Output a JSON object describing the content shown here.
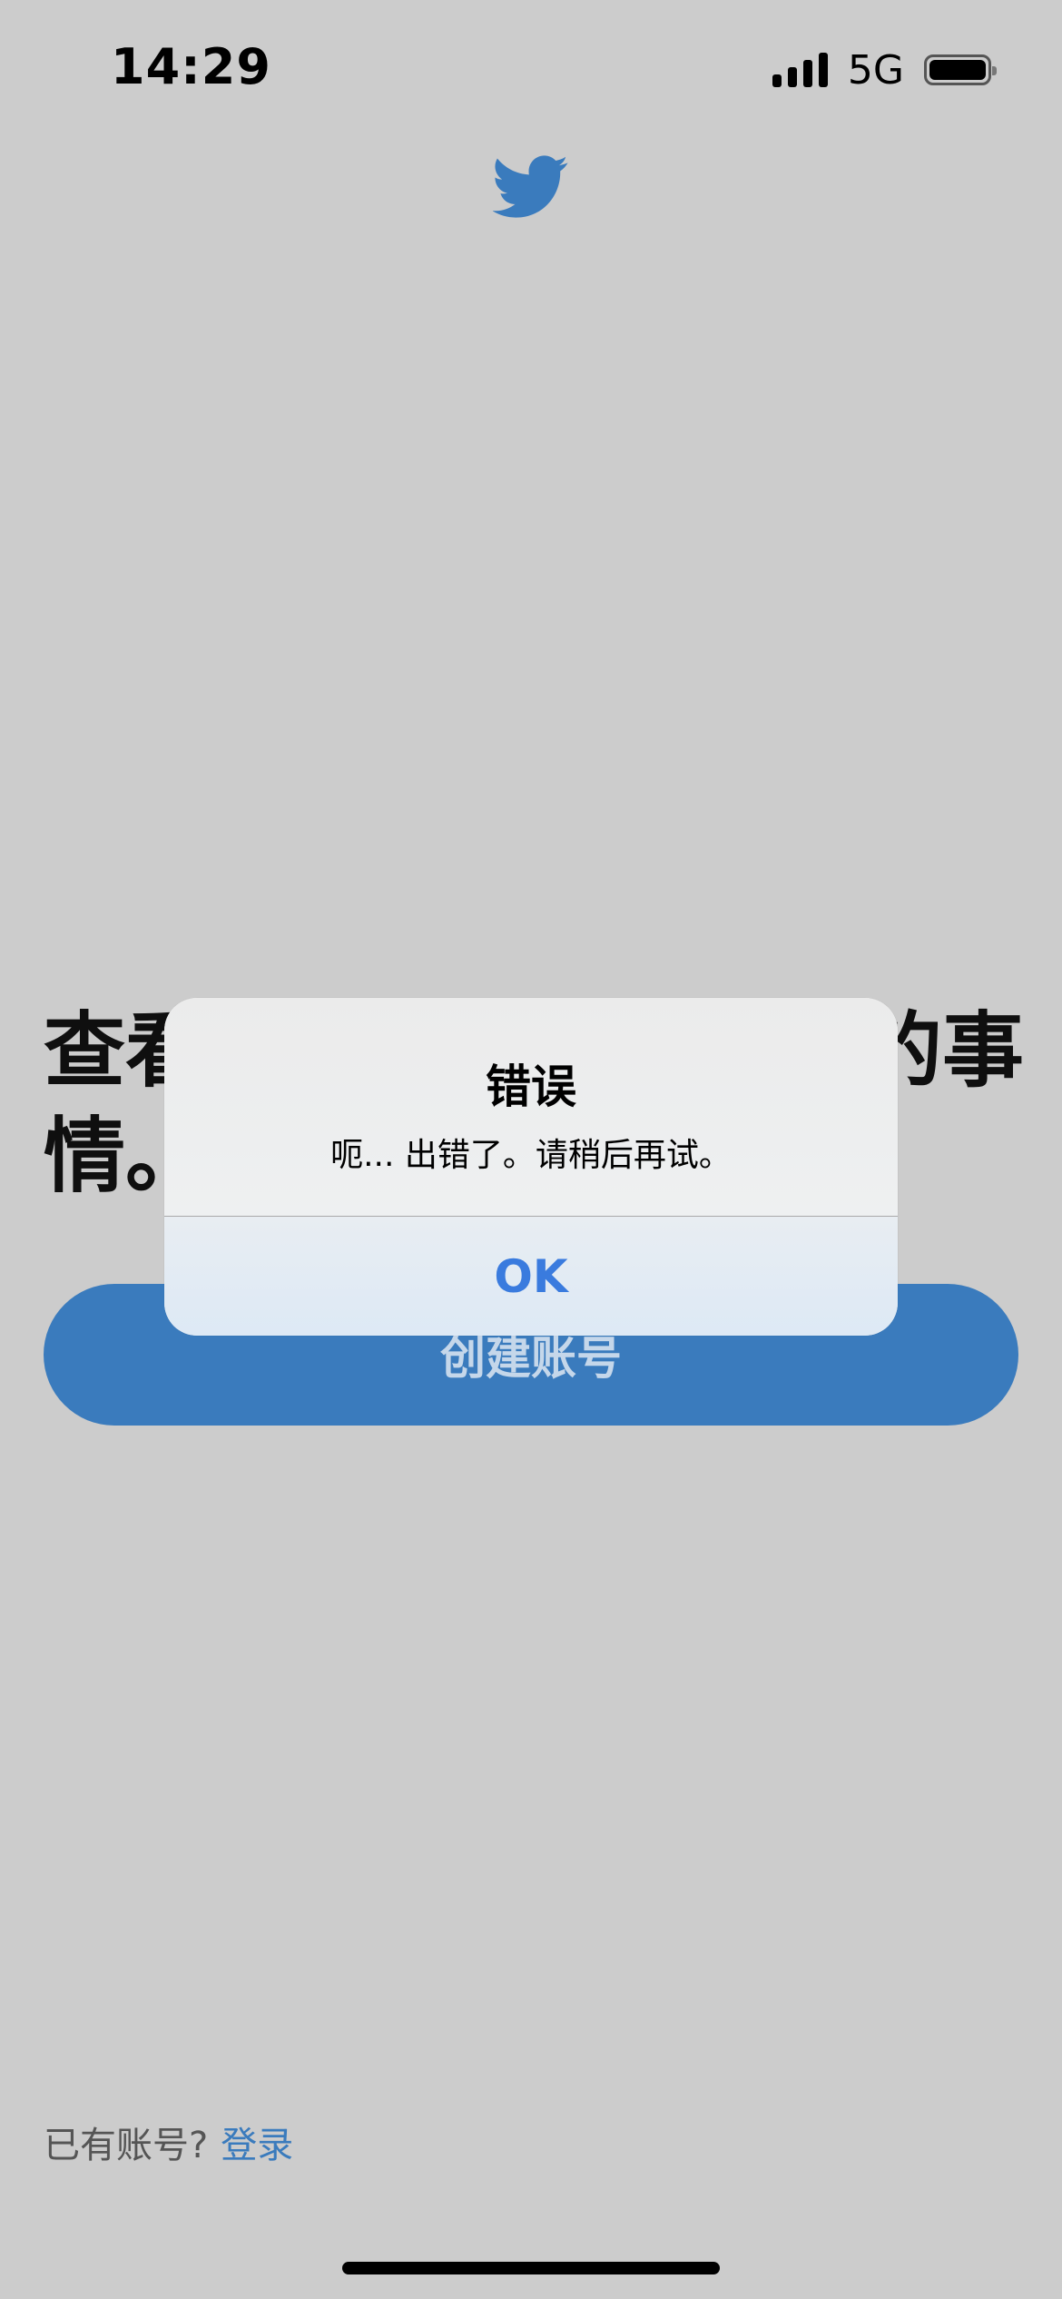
{
  "status_bar": {
    "time": "14:29",
    "network": "5G"
  },
  "icons": {
    "logo": "twitter-bird-icon",
    "signal": "cellular-signal-icon",
    "battery": "battery-icon"
  },
  "main": {
    "headline_line1_left": "查看",
    "headline_line1_right": "的事",
    "headline_line2": "情。",
    "create_account_label": "创建账号"
  },
  "footer": {
    "prompt": "已有账号?",
    "login_label": "登录"
  },
  "alert": {
    "title": "错误",
    "message": "呃... 出错了。请稍后再试。",
    "ok_label": "OK"
  },
  "colors": {
    "background": "#cccccc",
    "brand": "#3a7bbd",
    "alert_button": "#3a7bde"
  }
}
